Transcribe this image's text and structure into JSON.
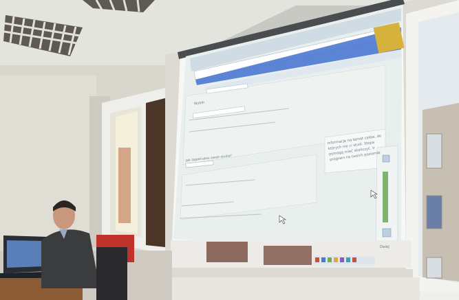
{
  "scene": {
    "subject": "projection screen showing a web application in a classroom",
    "colors": {
      "ceiling": "#e6e6e1",
      "wall": "#d8d6cf",
      "screen": "#e9f0ee",
      "screen_border": "#f7f9f7",
      "window_frame": "#f1f1ee",
      "window_glass": "#dce6ea",
      "building": "#c9c1b5",
      "accent_blue": "#4a6fd3",
      "laptop": "#2a2e34",
      "red_chair": "#c0332c",
      "person_shirt": "#3b3c3e",
      "table": "#8b5b36"
    }
  },
  "projected_app": {
    "tooltip_text": [
      "Informacje na temat celów, do",
      "których nie ci studi. Stopa",
      "pomogą mieć skończyć. Ir",
      "program na twoich poziomie"
    ],
    "button_label": "Dalej",
    "field_label": "Wybór",
    "section_heading": "Jak zapatrujesz swoje studia?"
  }
}
